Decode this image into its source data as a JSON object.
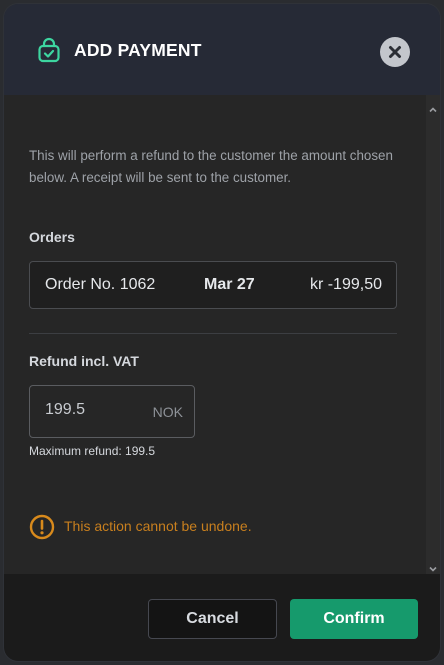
{
  "header": {
    "title": "ADD PAYMENT",
    "icon": "lock-icon",
    "close_icon": "close-icon"
  },
  "description": "This will perform a refund to the customer the amount chosen below. A receipt will be sent to the customer.",
  "orders": {
    "label": "Orders",
    "items": [
      {
        "number": "Order No. 1062",
        "date": "Mar 27",
        "amount": "kr -199,50"
      }
    ]
  },
  "refund": {
    "label": "Refund incl. VAT",
    "value": "199.5",
    "unit": "NOK",
    "max_text": "Maximum refund: 199.5"
  },
  "warning": {
    "icon": "warning-icon",
    "text": "This action cannot be undone."
  },
  "footer": {
    "cancel_label": "Cancel",
    "confirm_label": "Confirm"
  },
  "colors": {
    "accent": "#169a6c",
    "warning": "#c87f1e",
    "header_bg": "#262a36"
  }
}
